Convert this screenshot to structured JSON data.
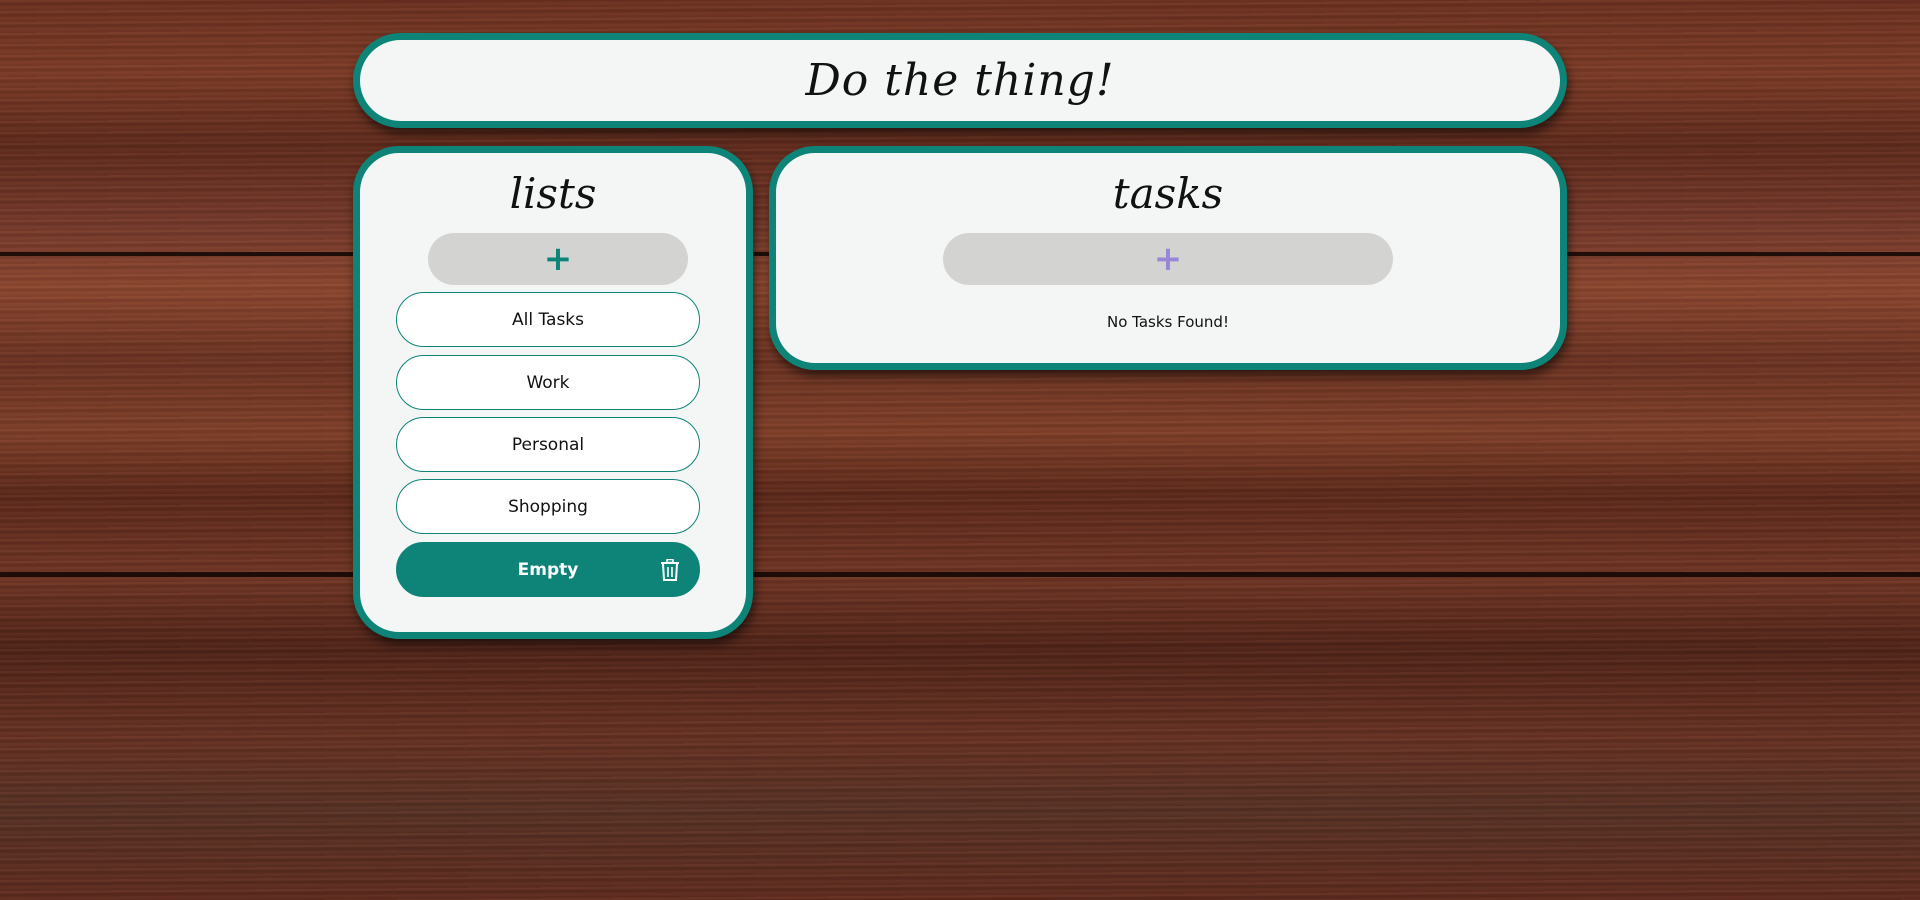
{
  "app": {
    "title": "Do the thing!"
  },
  "lists_panel": {
    "title": "lists",
    "add_label": "+",
    "items": [
      {
        "label": "All Tasks",
        "active": false
      },
      {
        "label": "Work",
        "active": false
      },
      {
        "label": "Personal",
        "active": false
      },
      {
        "label": "Shopping",
        "active": false
      },
      {
        "label": "Empty",
        "active": true
      }
    ]
  },
  "tasks_panel": {
    "title": "tasks",
    "add_label": "+",
    "empty_message": "No Tasks Found!"
  },
  "colors": {
    "accent": "#0e8478",
    "panel_bg": "#f3f6f4",
    "add_button_bg": "#d3d4d2",
    "tasks_plus": "#9a86d8"
  },
  "icons": {
    "delete_list": "trash-icon"
  }
}
